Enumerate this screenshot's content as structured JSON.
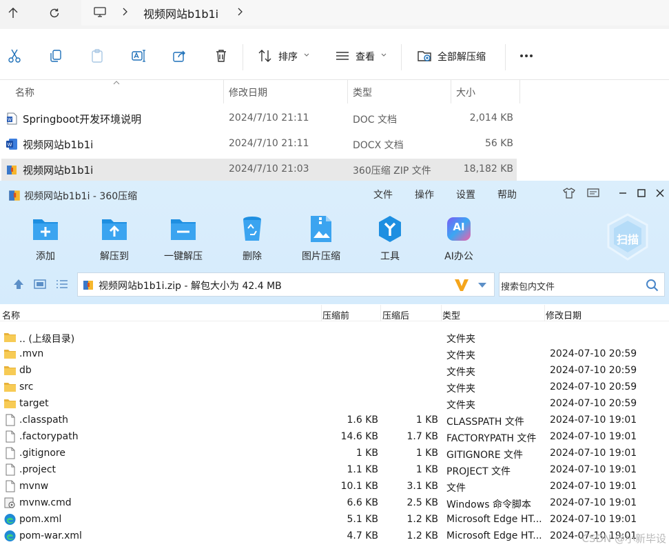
{
  "explorer": {
    "breadcrumb": {
      "folder": "视频网站b1b1i"
    },
    "toolbar": {
      "sort_label": "排序",
      "view_label": "查看",
      "extract_all_label": "全部解压缩"
    },
    "columns": {
      "name": "名称",
      "date": "修改日期",
      "type": "类型",
      "size": "大小"
    },
    "files": [
      {
        "name": "Springboot开发环境说明",
        "date": "2024/7/10 21:11",
        "type": "DOC 文档",
        "size": "2,014 KB",
        "icon": "word-doc-icon"
      },
      {
        "name": "视频网站b1b1i",
        "date": "2024/7/10 21:11",
        "type": "DOCX 文档",
        "size": "56 KB",
        "icon": "word-docx-icon"
      },
      {
        "name": "视频网站b1b1i",
        "date": "2024/7/10 21:03",
        "type": "360压缩 ZIP 文件",
        "size": "18,182 KB",
        "icon": "zip-archive-icon",
        "selected": true
      }
    ]
  },
  "zip": {
    "title": "视频网站b1b1i - 360压缩",
    "menu": [
      "文件",
      "操作",
      "设置",
      "帮助"
    ],
    "tools": [
      {
        "label": "添加"
      },
      {
        "label": "解压到"
      },
      {
        "label": "一键解压"
      },
      {
        "label": "删除"
      },
      {
        "label": "图片压缩"
      },
      {
        "label": "工具"
      },
      {
        "label": "AI办公"
      }
    ],
    "ai_badge": "AI",
    "scan_label": "扫描",
    "path_text": "视频网站b1b1i.zip - 解包大小为 42.4 MB",
    "search_placeholder": "搜索包内文件",
    "columns": {
      "name": "名称",
      "before": "压缩前",
      "after": "压缩后",
      "type": "类型",
      "date": "修改日期"
    },
    "rows": [
      {
        "name": ".. (上级目录)",
        "before": "",
        "after": "",
        "type": "文件夹",
        "date": "",
        "icon": "folder"
      },
      {
        "name": ".mvn",
        "before": "",
        "after": "",
        "type": "文件夹",
        "date": "2024-07-10 20:59",
        "icon": "folder"
      },
      {
        "name": "db",
        "before": "",
        "after": "",
        "type": "文件夹",
        "date": "2024-07-10 20:59",
        "icon": "folder"
      },
      {
        "name": "src",
        "before": "",
        "after": "",
        "type": "文件夹",
        "date": "2024-07-10 20:59",
        "icon": "folder"
      },
      {
        "name": "target",
        "before": "",
        "after": "",
        "type": "文件夹",
        "date": "2024-07-10 20:59",
        "icon": "folder"
      },
      {
        "name": ".classpath",
        "before": "1.6 KB",
        "after": "1 KB",
        "type": "CLASSPATH 文件",
        "date": "2024-07-10 19:01",
        "icon": "file"
      },
      {
        "name": ".factorypath",
        "before": "14.6 KB",
        "after": "1.7 KB",
        "type": "FACTORYPATH 文件",
        "date": "2024-07-10 19:01",
        "icon": "file"
      },
      {
        "name": ".gitignore",
        "before": "1 KB",
        "after": "1 KB",
        "type": "GITIGNORE 文件",
        "date": "2024-07-10 19:01",
        "icon": "file"
      },
      {
        "name": ".project",
        "before": "1.1 KB",
        "after": "1 KB",
        "type": "PROJECT 文件",
        "date": "2024-07-10 19:01",
        "icon": "file"
      },
      {
        "name": "mvnw",
        "before": "10.1 KB",
        "after": "3.1 KB",
        "type": "文件",
        "date": "2024-07-10 19:01",
        "icon": "file"
      },
      {
        "name": "mvnw.cmd",
        "before": "6.6 KB",
        "after": "2.5 KB",
        "type": "Windows 命令脚本",
        "date": "2024-07-10 19:01",
        "icon": "cmd"
      },
      {
        "name": "pom.xml",
        "before": "5.1 KB",
        "after": "1.2 KB",
        "type": "Microsoft Edge HT...",
        "date": "2024-07-10 19:01",
        "icon": "edge"
      },
      {
        "name": "pom-war.xml",
        "before": "4.7 KB",
        "after": "1.2 KB",
        "type": "Microsoft Edge HT...",
        "date": "2024-07-10 19:01",
        "icon": "edge"
      }
    ]
  },
  "watermark": "CSDN @小新毕设",
  "colors": {
    "zip_header_bg": "#d5ebfc",
    "tool_blue": "#1e8fe1",
    "selected_row": "#e8e8e8"
  }
}
